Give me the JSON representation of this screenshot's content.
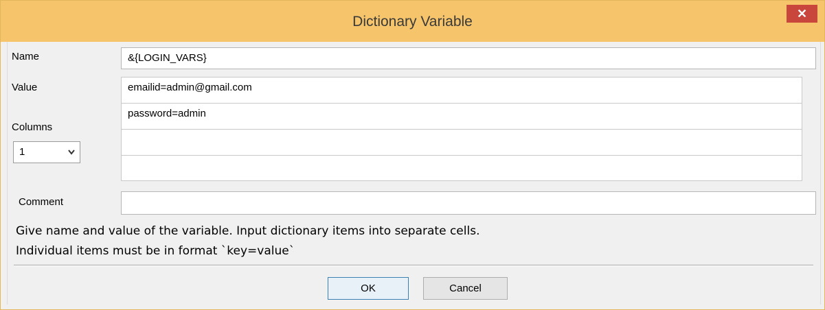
{
  "window": {
    "title": "Dictionary Variable",
    "close_label": "✕"
  },
  "form": {
    "name_label": "Name",
    "name_value": "&{LOGIN_VARS}",
    "value_label": "Value",
    "columns_label": "Columns",
    "columns_value": "1",
    "cells": [
      "emailid=admin@gmail.com",
      "password=admin",
      "",
      ""
    ],
    "comment_label": "Comment",
    "comment_value": ""
  },
  "help": {
    "line1": "Give name and value of the variable. Input dictionary items into separate cells.",
    "line2": "Individual items must be in format `key=value`"
  },
  "buttons": {
    "ok": "OK",
    "cancel": "Cancel"
  },
  "colors": {
    "titlebar": "#f6c46a",
    "close": "#c9463d",
    "dialog_bg": "#f0f0f0"
  },
  "icons": {
    "close": "close-icon",
    "dropdown": "chevron-down-icon"
  }
}
